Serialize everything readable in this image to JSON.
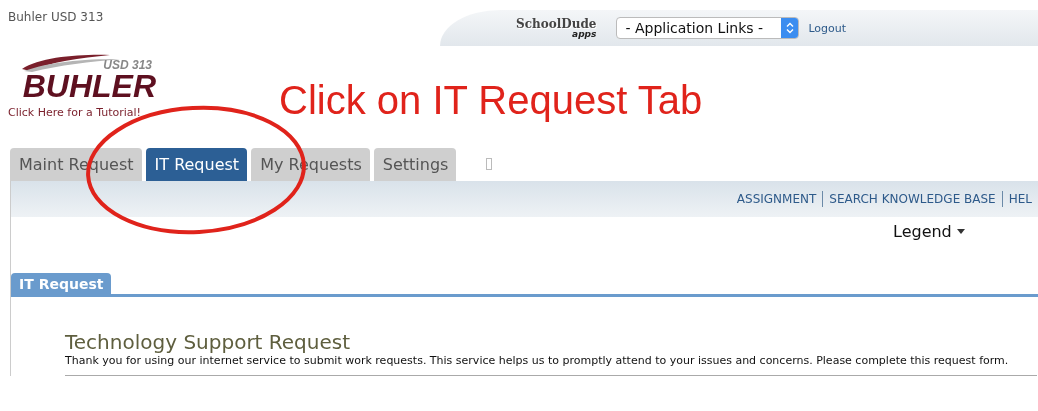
{
  "site_name": "Buhler USD 313",
  "header": {
    "brand": "SchoolDude",
    "brand_sub": "apps",
    "app_select": {
      "value": "- Application Links -"
    },
    "logout": "Logout"
  },
  "logo": {
    "top": "USD 313",
    "name": "BUHLER"
  },
  "tutorial_link": "Click Here for a Tutorial!",
  "annotation": {
    "text": "Click on IT Request Tab"
  },
  "tabs": [
    {
      "label": "Maint Request",
      "selected": false
    },
    {
      "label": "IT Request",
      "selected": true
    },
    {
      "label": "My Requests",
      "selected": false
    },
    {
      "label": "Settings",
      "selected": false
    }
  ],
  "nav_links": [
    "ASSIGNMENT",
    "SEARCH KNOWLEDGE BASE",
    "HEL"
  ],
  "legend": "Legend",
  "section_tab": "IT Request",
  "form": {
    "title": "Technology Support Request",
    "description": "Thank you for using our internet service to submit work requests. This service helps us to promptly attend to your issues and concerns. Please complete this request form."
  }
}
